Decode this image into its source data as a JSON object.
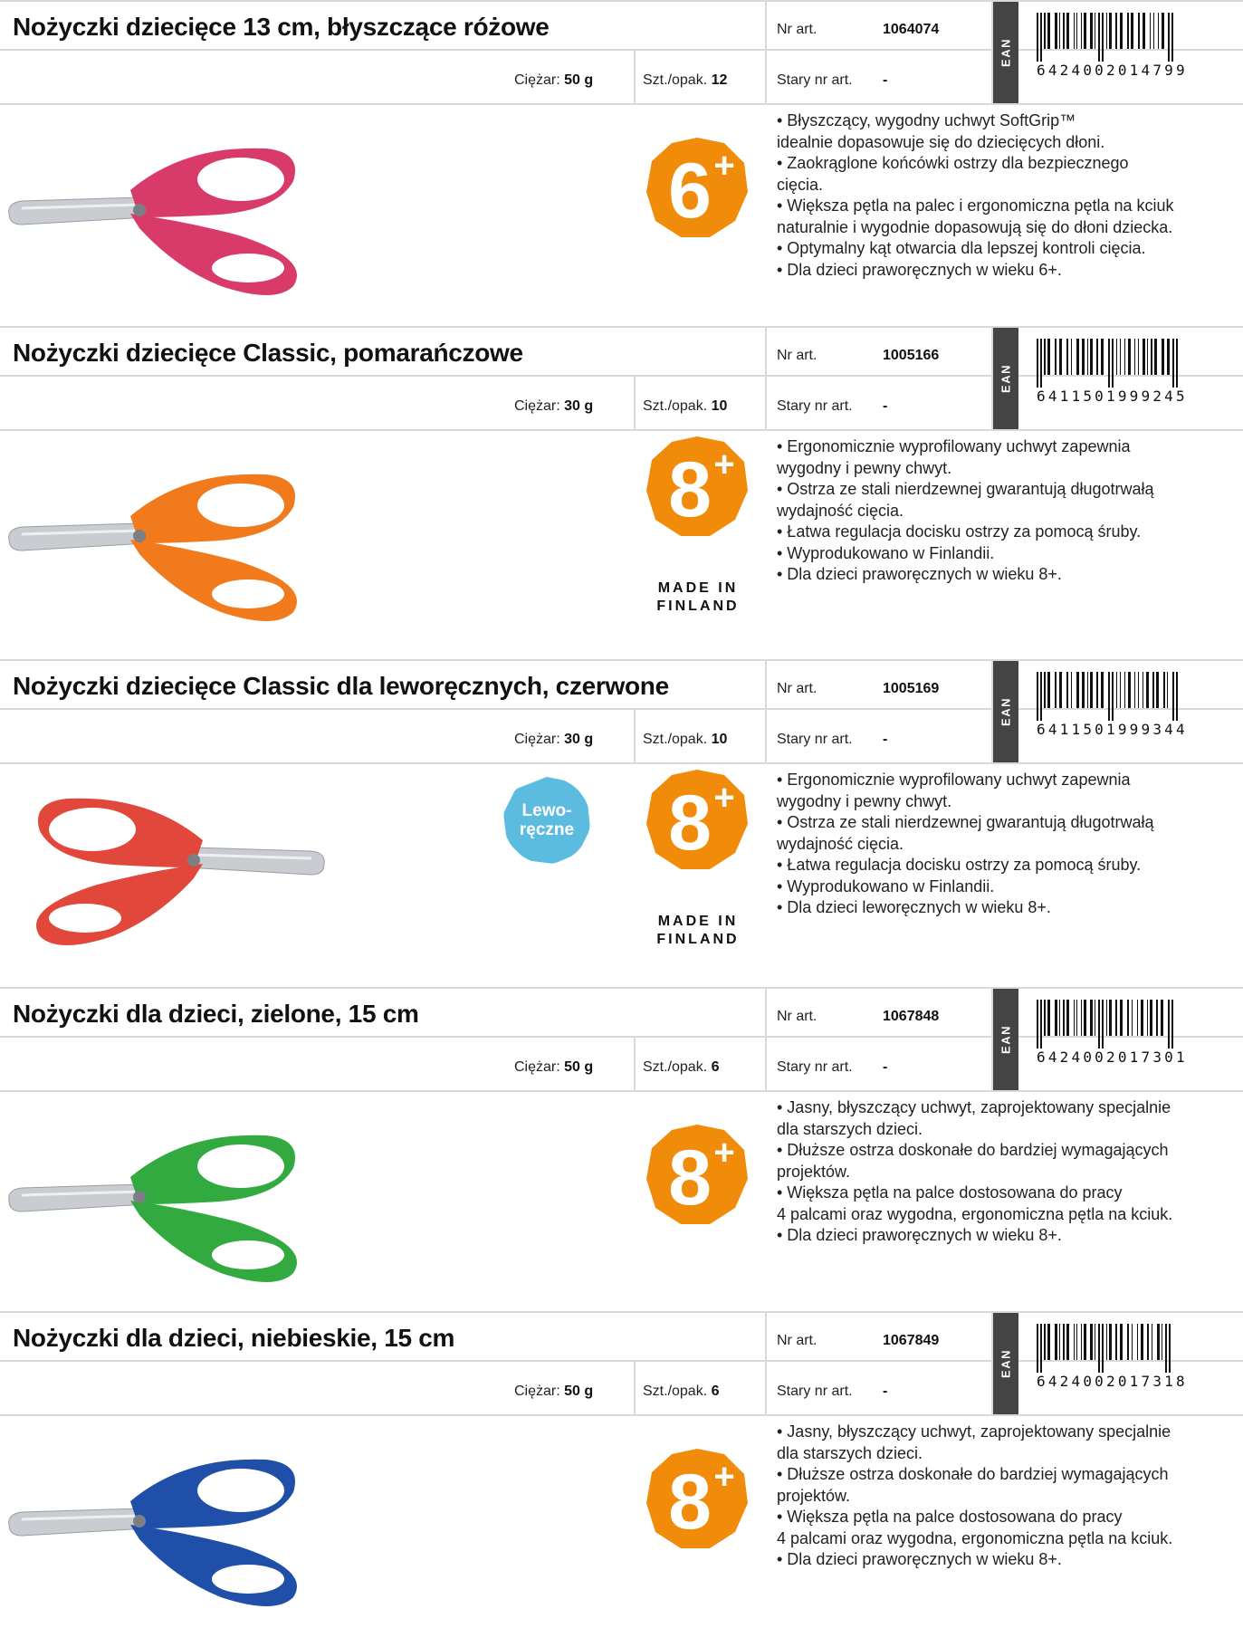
{
  "products": [
    {
      "title": "Nożyczki dziecięce 13 cm, błyszczące różowe",
      "nr_art_label": "Nr art.",
      "nr_art": "1064074",
      "weight_label": "Ciężar:",
      "weight": "50 g",
      "pack_label": "Szt./opak.",
      "pack": "12",
      "old_nr_label": "Stary nr art.",
      "old_nr": "-",
      "ean_label": "EAN",
      "ean": "6424002014799",
      "age": "6+",
      "made_in": "",
      "lefty": "",
      "color": "#d83a6a",
      "features": [
        "• Błyszczący, wygodny uchwyt SoftGrip™",
        "idealnie dopasowuje się do dziecięcych dłoni.",
        "• Zaokrąglone końcówki ostrzy dla bezpiecznego",
        "cięcia.",
        "• Większa pętla na palec i ergonomiczna pętla na kciuk",
        "naturalnie i wygodnie dopasowują się do dłoni dziecka.",
        "• Optymalny kąt otwarcia dla lepszej kontroli cięcia.",
        "• Dla dzieci praworęcznych w wieku 6+."
      ]
    },
    {
      "title": "Nożyczki dziecięce Classic, pomarańczowe",
      "nr_art_label": "Nr art.",
      "nr_art": "1005166",
      "weight_label": "Ciężar:",
      "weight": "30 g",
      "pack_label": "Szt./opak.",
      "pack": "10",
      "old_nr_label": "Stary nr art.",
      "old_nr": "-",
      "ean_label": "EAN",
      "ean": "6411501999245",
      "age": "8+",
      "made_in": "MADE IN FINLAND",
      "lefty": "",
      "color": "#f07a1c",
      "features": [
        "• Ergonomicznie wyprofilowany uchwyt zapewnia",
        "wygodny i pewny chwyt.",
        "• Ostrza ze stali nierdzewnej gwarantują długotrwałą",
        "wydajność cięcia.",
        "• Łatwa regulacja docisku ostrzy za pomocą śruby.",
        "• Wyprodukowano w Finlandii.",
        "• Dla dzieci praworęcznych w wieku 8+."
      ]
    },
    {
      "title": "Nożyczki dziecięce Classic dla leworęcznych, czerwone",
      "nr_art_label": "Nr art.",
      "nr_art": "1005169",
      "weight_label": "Ciężar:",
      "weight": "30 g",
      "pack_label": "Szt./opak.",
      "pack": "10",
      "old_nr_label": "Stary nr art.",
      "old_nr": "-",
      "ean_label": "EAN",
      "ean": "6411501999344",
      "age": "8+",
      "made_in": "MADE IN FINLAND",
      "lefty": "Lewo-\nręczne",
      "color": "#e2473b",
      "features": [
        "• Ergonomicznie wyprofilowany uchwyt zapewnia",
        "wygodny i pewny chwyt.",
        "• Ostrza ze stali nierdzewnej gwarantują długotrwałą",
        "wydajność cięcia.",
        "• Łatwa regulacja docisku ostrzy za pomocą śruby.",
        "• Wyprodukowano w Finlandii.",
        "• Dla dzieci leworęcznych w wieku 8+."
      ]
    },
    {
      "title": "Nożyczki dla dzieci, zielone, 15 cm",
      "nr_art_label": "Nr art.",
      "nr_art": "1067848",
      "weight_label": "Ciężar:",
      "weight": "50 g",
      "pack_label": "Szt./opak.",
      "pack": "6",
      "old_nr_label": "Stary nr art.",
      "old_nr": "-",
      "ean_label": "EAN",
      "ean": "6424002017301",
      "age": "8+",
      "made_in": "",
      "lefty": "",
      "color": "#33aa3f",
      "features": [
        "• Jasny, błyszczący uchwyt, zaprojektowany specjalnie",
        "dla starszych dzieci.",
        "• Dłuższe ostrza doskonałe do bardziej wymagających",
        "projektów.",
        "• Większa pętla na palce dostosowana do pracy",
        "4 palcami oraz wygodna, ergonomiczna pętla na kciuk.",
        "• Dla dzieci praworęcznych w wieku 8+."
      ]
    },
    {
      "title": "Nożyczki dla dzieci, niebieskie, 15 cm",
      "nr_art_label": "Nr art.",
      "nr_art": "1067849",
      "weight_label": "Ciężar:",
      "weight": "50 g",
      "pack_label": "Szt./opak.",
      "pack": "6",
      "old_nr_label": "Stary nr art.",
      "old_nr": "-",
      "ean_label": "EAN",
      "ean": "6424002017318",
      "age": "8+",
      "made_in": "",
      "lefty": "",
      "color": "#1f4fa8",
      "features": [
        "• Jasny, błyszczący uchwyt, zaprojektowany specjalnie",
        "dla starszych dzieci.",
        "• Dłuższe ostrza doskonałe do bardziej wymagających",
        "projektów.",
        "• Większa pętla na palce dostosowana do pracy",
        "4 palcami oraz wygodna, ergonomiczna pętla na kciuk.",
        "• Dla dzieci praworęcznych w wieku 8+."
      ]
    }
  ],
  "badge_color": "#f18b0a"
}
